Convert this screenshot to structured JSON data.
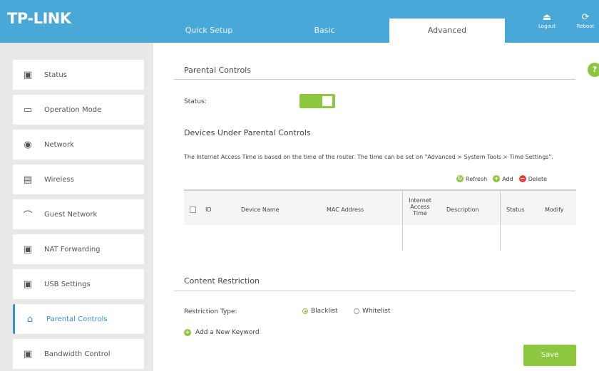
{
  "header": {
    "logo": "TP-LINK",
    "tabs": [
      {
        "label": "Quick Setup"
      },
      {
        "label": "Basic"
      },
      {
        "label": "Advanced"
      }
    ],
    "icons": [
      {
        "name": "logout-icon",
        "label": "Logout"
      },
      {
        "name": "reboot-icon",
        "label": "Reboot"
      }
    ]
  },
  "sidebar": {
    "items": [
      {
        "label": "Status",
        "icon": "status-icon"
      },
      {
        "label": "Operation Mode",
        "icon": "monitor-icon"
      },
      {
        "label": "Network",
        "icon": "globe-icon"
      },
      {
        "label": "Wireless",
        "icon": "wireless-icon"
      },
      {
        "label": "Guest Network",
        "icon": "guest-icon"
      },
      {
        "label": "NAT Forwarding",
        "icon": "nat-icon"
      },
      {
        "label": "USB Settings",
        "icon": "usb-icon"
      },
      {
        "label": "Parental Controls",
        "icon": "family-icon"
      },
      {
        "label": "Bandwidth Control",
        "icon": "bandwidth-icon"
      }
    ]
  },
  "main": {
    "parental_title": "Parental Controls",
    "status_label": "Status:",
    "status_on": true,
    "devices_title": "Devices Under Parental Controls",
    "description": "The Internet Access Time is based on the time of the router. The time can be set on \"Advanced > System Tools > Time Settings\".",
    "actions": {
      "refresh": "Refresh",
      "add": "Add",
      "delete": "Delete"
    },
    "table_headers": {
      "id": "ID",
      "device_name": "Device Name",
      "mac": "MAC Address",
      "internet_time": "Internet Access Time",
      "description": "Description",
      "status": "Status",
      "modify": "Modify"
    },
    "content_title": "Content Restriction",
    "restriction_label": "Restriction Type:",
    "restriction_options": [
      {
        "label": "Blacklist",
        "selected": true
      },
      {
        "label": "Whitelist",
        "selected": false
      }
    ],
    "add_keyword": "Add a New Keyword",
    "save": "Save"
  }
}
